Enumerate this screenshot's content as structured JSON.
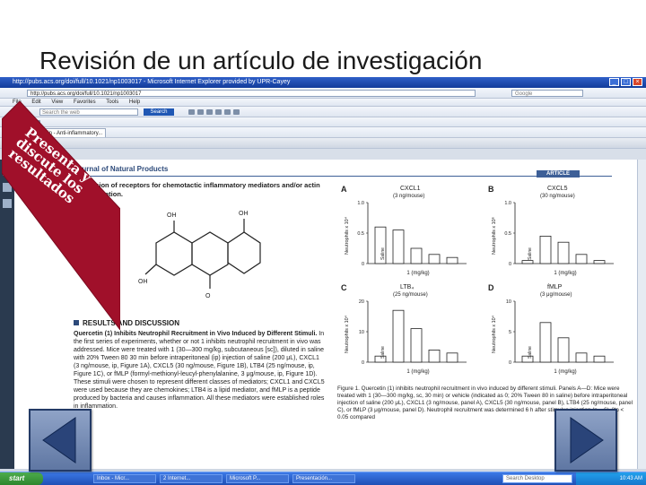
{
  "slide": {
    "title": "Revisión de un artículo de investigación",
    "ribbon_text": "Presenta y discute los resultados"
  },
  "browser": {
    "title_bar": "http://pubs.acs.org/doi/full/10.1021/np1003017 - Microsoft Internet Explorer provided by UPR-Cayey",
    "address": "http://pubs.acs.org/doi/full/10.1021/np1003017",
    "search_placeholder": "Google",
    "menu": [
      "File",
      "Edit",
      "View",
      "Favorites",
      "Tools",
      "Help"
    ],
    "search_box": "Search the web",
    "search_button": "Search",
    "tab_label": "Quercetin - Anti-inflammatory..."
  },
  "document": {
    "journal": "Journal of Natural Products",
    "article_tag": "ARTICLE",
    "para1": "expression of receptors for chemotactic inflammatory mediators and/or actin polymerization.",
    "section_head": "RESULTS AND DISCUSSION",
    "subhead": "Quercetin (1) Inhibits Neutrophil Recruitment in Vivo Induced by Different Stimuli.",
    "para2": "In the first series of experiments, whether or not 1 inhibits neutrophil recruitment in vivo was addressed. Mice were treated with 1 (30—300 mg/kg, subcutaneous [sc]), diluted in saline with 20% Tween 80 30 min before intraperitoneal (ip) injection of saline (200 μL), CXCL1 (3 ng/mouse, ip, Figure 1A), CXCL5 (30 ng/mouse, Figure 1B), LTB4 (25 ng/mouse, ip, Figure 1C), or fMLP (formyl-methionyl-leucyl-phenylalanine, 3 μg/mouse, ip, Figure 1D). These stimuli were chosen to represent different classes of mediators; CXCL1 and CXCL5 were used because they are chemokines; LTB4 is a lipid mediator, and fMLP is a peptide produced by bacteria and causes inflammation. All these mediators were established roles in inflammation.",
    "caption": "Figure 1. Quercetin (1) inhibits neutrophil recruitment in vivo induced by different stimuli. Panels A—D: Mice were treated with 1 (30—300 mg/kg, sc, 30 min) or vehicle (indicated as 0; 20% Tween 80 in saline) before intraperitoneal injection of saline (200 μL), CXCL1 (3 ng/mouse, panel A), CXCL5 (30 ng/mouse, panel B), LTB4 (25 ng/mouse, panel C), or fMLP (3 μg/mouse, panel D). Neutrophil recruitment was determined 6 h after stimulus injection (n = 6). [*p < 0.05 compared"
  },
  "figure": {
    "panels": [
      {
        "letter": "A",
        "title": "CXCL1",
        "sub": "(3 ng/mouse)",
        "ylabel": "Neutrophils x 10⁴",
        "xlabel": "1 (mg/kg)",
        "bars": [
          0.6,
          0.55,
          0.25,
          0.15,
          0.1
        ],
        "ticks": [
          "0",
          "0.5",
          "1.0"
        ]
      },
      {
        "letter": "B",
        "title": "CXCL5",
        "sub": "(30 ng/mouse)",
        "ylabel": "Neutrophils x 10⁶",
        "xlabel": "1 (mg/kg)",
        "bars": [
          0.05,
          0.45,
          0.35,
          0.15,
          0.05
        ],
        "ticks": [
          "0",
          "0.5",
          "1.0"
        ]
      },
      {
        "letter": "C",
        "title": "LTB₄",
        "sub": "(25 ng/mouse)",
        "ylabel": "Neutrophils x 10⁴",
        "xlabel": "1 (mg/kg)",
        "bars": [
          0.1,
          0.85,
          0.55,
          0.2,
          0.15
        ],
        "ticks": [
          "0",
          "10",
          "20"
        ]
      },
      {
        "letter": "D",
        "title": "fMLP",
        "sub": "(3 μg/mouse)",
        "ylabel": "Neutrophils x 10⁴",
        "xlabel": "1 (mg/kg)",
        "bars": [
          0.1,
          0.65,
          0.4,
          0.15,
          0.1
        ],
        "ticks": [
          "0",
          "5",
          "10"
        ]
      }
    ],
    "saline_label": "Saline"
  },
  "taskbar": {
    "start": "start",
    "tasks": [
      "Inbox - Micr...",
      "2 Internet...",
      "Microsoft P...",
      "Presentación..."
    ],
    "deskbar": "Search Desktop",
    "clock": "10:43 AM"
  },
  "colors": {
    "ribbon": "#a0102a",
    "nav_button": "#6f86b0",
    "accent": "#2d4a7a"
  }
}
